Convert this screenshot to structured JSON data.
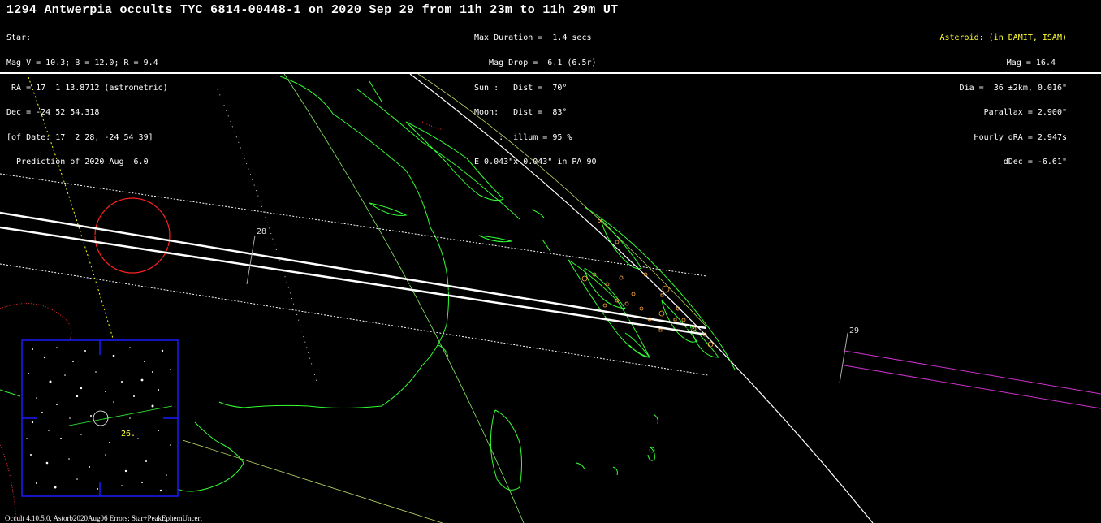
{
  "title": "1294 Antwerpia occults TYC 6814-00448-1 on 2020 Sep 29 from 11h 23m to 11h 29m UT",
  "star_block": [
    "Star:",
    "Mag V = 10.3; B = 12.0; R = 9.4",
    " RA = 17  1 13.8712 (astrometric)",
    "Dec = -24 52 54.318",
    "[of Date: 17  2 28, -24 54 39]",
    "  Prediction of 2020 Aug  6.0"
  ],
  "event_block": [
    "Max Duration =  1.4 secs",
    "   Mag Drop =  6.1 (6.5r)",
    "Sun :   Dist =  70°",
    "Moon:   Dist =  83°",
    "     :  illum = 95 %",
    "E 0.043\"x 0.043\" in PA 90"
  ],
  "asteroid_header": "Asteroid: (in DAMIT, ISAM)",
  "asteroid_block": [
    "Mag = 16.4",
    "Dia =  36 ±2km, 0.016\"",
    "Parallax = 2.900\"",
    "Hourly dRA = 2.947s",
    "dDec = -6.61\""
  ],
  "map": {
    "time_labels": [
      "28",
      "29"
    ],
    "finder_label": "26."
  },
  "footer": "Occult 4.10.5.0, Astorb2020Aug06  Errors: Star+PeakEphemUncert",
  "colors": {
    "coastline": "#33ff33",
    "path_lines": "#ffffff",
    "sigma_lines": "#ffffff",
    "uncertainty_circle": "#ff0000",
    "finder_frame": "#1a1aff",
    "terminator": "#ffff00",
    "asteroid_header": "#ffff33",
    "ecliptic": "#cc33cc",
    "sites": "#ffaa44"
  }
}
